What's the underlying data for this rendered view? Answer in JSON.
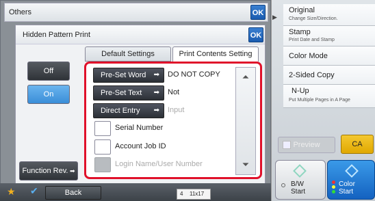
{
  "outer": {
    "title": "Others",
    "ok": "OK"
  },
  "dialog": {
    "title": "Hidden Pattern Print",
    "ok": "OK"
  },
  "tabs": [
    {
      "label": "Default Settings"
    },
    {
      "label": "Print Contents Setting"
    }
  ],
  "left": {
    "off": "Off",
    "on": "On",
    "function_rev": "Function Rev."
  },
  "preset": {
    "buttons": [
      {
        "label": "Pre-Set Word",
        "value": "DO NOT COPY"
      },
      {
        "label": "Pre-Set Text",
        "value": "Not"
      },
      {
        "label": "Direct Entry",
        "value": "Input"
      }
    ],
    "checkboxes": [
      {
        "label": "Serial Number"
      },
      {
        "label": "Account Job ID"
      },
      {
        "label": "Login Name/User Number"
      }
    ]
  },
  "bottom": {
    "back": "Back",
    "counter": "4",
    "paper": "11x17"
  },
  "right": {
    "items": [
      {
        "label": "Original",
        "sub": "Change Size/Direction."
      },
      {
        "label": "Stamp",
        "sub": "Print Date and Stamp"
      },
      {
        "label": "Color Mode",
        "sub": ""
      },
      {
        "label": "2-Sided Copy",
        "sub": ""
      },
      {
        "label": "N-Up",
        "sub": "Put Multiple Pages in A Page"
      }
    ],
    "preview": "Preview",
    "ca": "CA",
    "bw_start": [
      "B/W",
      "Start"
    ],
    "color_start": [
      "Color",
      "Start"
    ]
  }
}
